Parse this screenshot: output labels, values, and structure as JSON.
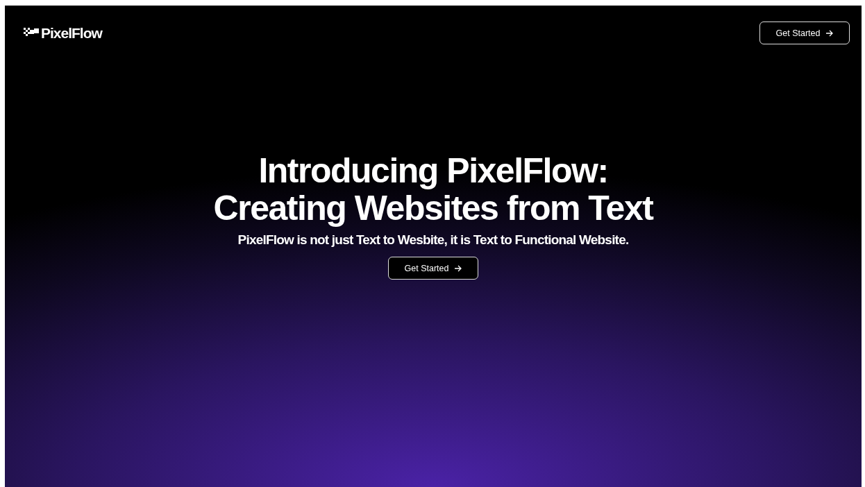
{
  "header": {
    "logo": "PixelFlow",
    "cta": "Get Started"
  },
  "hero": {
    "title_lines": [
      "Introducing PixelFlow:",
      "Creating Websites from Text"
    ],
    "subtitle": "PixelFlow is not just Text to Wesbite, it is Text to Functional Website.",
    "cta": "Get Started"
  }
}
